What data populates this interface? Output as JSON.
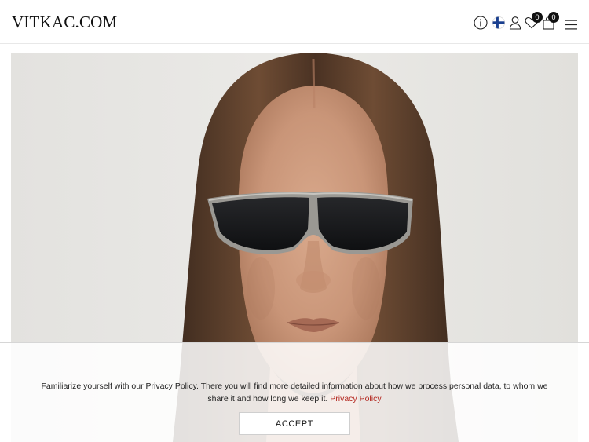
{
  "header": {
    "logo": "VITKAC.COM",
    "wishlist_count": "0",
    "cart_count": "0",
    "icons": [
      "info-icon",
      "finland-flag-icon",
      "user-icon",
      "heart-icon",
      "shopping-bag-icon",
      "menu-icon"
    ]
  },
  "cookie": {
    "text": "Familiarize yourself with our Privacy Policy. There you will find more detailed information about how we process personal data, to whom we share it and how long we keep it.",
    "link_label": "Privacy Policy",
    "accept_label": "ACCEPT"
  },
  "colors": {
    "link": "#b3261e",
    "badge": "#111111",
    "flag_blue": "#1a3f8f"
  }
}
